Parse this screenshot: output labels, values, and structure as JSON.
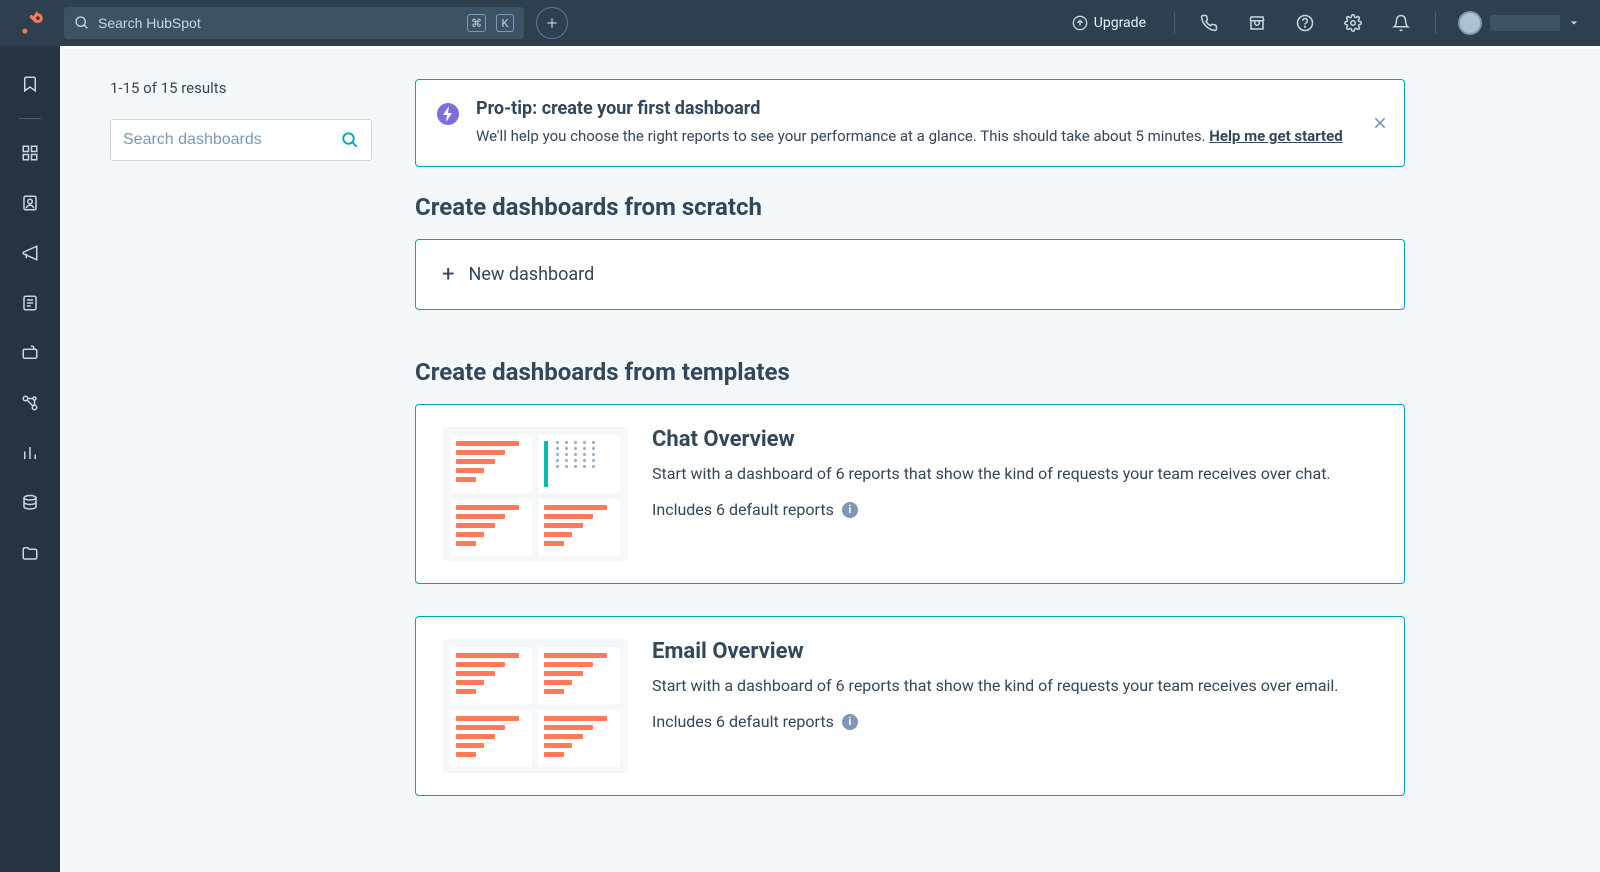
{
  "topnav": {
    "search_placeholder": "Search HubSpot",
    "kbd1": "⌘",
    "kbd2": "K",
    "upgrade_label": "Upgrade"
  },
  "left": {
    "results_text": "1-15 of 15 results",
    "dash_search_placeholder": "Search dashboards"
  },
  "protip": {
    "title": "Pro-tip: create your first dashboard",
    "body": "We'll help you choose the right reports to see your performance at a glance. This should take about 5 minutes. ",
    "help_link": "Help me get started"
  },
  "scratch": {
    "heading": "Create dashboards from scratch",
    "new_label": "New dashboard"
  },
  "templates": {
    "heading": "Create dashboards from templates",
    "items": [
      {
        "title": "Chat Overview",
        "desc": "Start with a dashboard of 6 reports that show the kind of requests your team receives over chat.",
        "includes": "Includes 6 default reports"
      },
      {
        "title": "Email Overview",
        "desc": "Start with a dashboard of 6 reports that show the kind of requests your team receives over email.",
        "includes": "Includes 6 default reports"
      }
    ]
  }
}
